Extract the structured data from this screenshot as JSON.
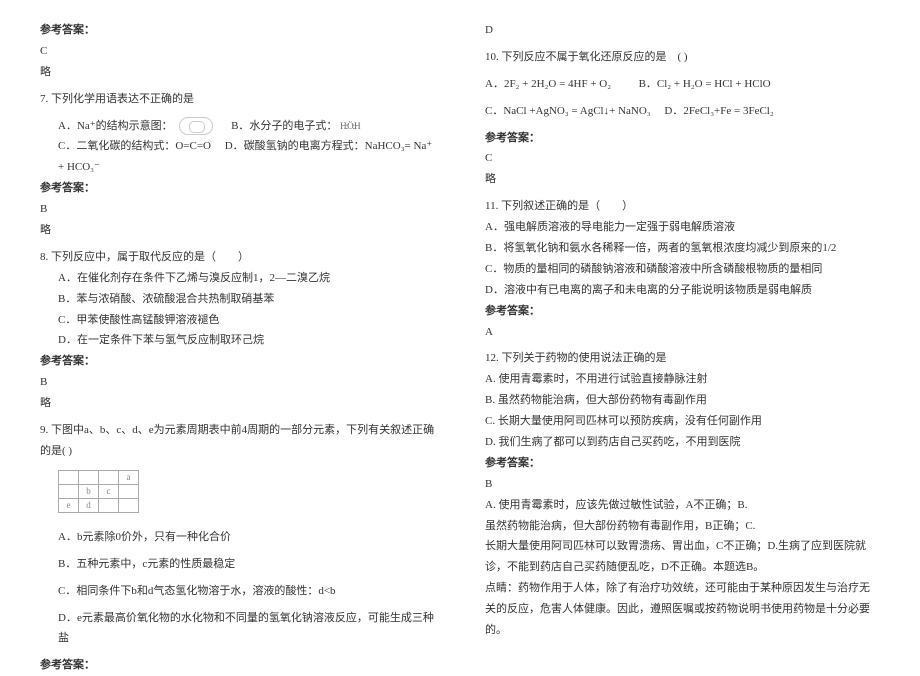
{
  "left": {
    "ans_label": "参考答案：",
    "lue": "略",
    "q6_ans": "C",
    "q7_stem": "7. 下列化学用语表达不正确的是",
    "q7_a": "A．Na⁺的结构示意图：",
    "q7_b": "B．水分子的电子式：",
    "q7_c": "C．二氧化碳的结构式：O=C=O",
    "q7_d": "D．碳酸氢钠的电离方程式：NaHCO₃= Na⁺ + HCO₃⁻",
    "q7_ans": "B",
    "q8_stem": "8. 下列反应中，属于取代反应的是（　　）",
    "q8_a": "A．在催化剂存在条件下乙烯与溴反应制1，2—二溴乙烷",
    "q8_b": "B．苯与浓硝酸、浓硫酸混合共热制取硝基苯",
    "q8_c": "C．甲苯使酸性高锰酸钾溶液褪色",
    "q8_d": "D．在一定条件下苯与氢气反应制取环己烷",
    "q8_ans": "B",
    "q9_stem": "9. 下图中a、b、c、d、e为元素周期表中前4周期的一部分元素，下列有关叙述正确的是(   )",
    "q9_a": "A．b元素除0价外，只有一种化合价",
    "q9_b": "B．五种元素中，c元素的性质最稳定",
    "q9_c": "C．相同条件下b和d气态氢化物溶于水，溶液的酸性：d<b",
    "q9_d": "D．e元素最高价氧化物的水化物和不同量的氢氧化钠溶液反应，可能生成三种盐",
    "q9_ans_label": "参考答案："
  },
  "right": {
    "q9_ans": "D",
    "q10_stem": "10. 下列反应不属于氧化还原反应的是　(    )",
    "q10_a": "A．2F₂ + 2H₂O = 4HF + O₂",
    "q10_b": "B．Cl₂ + H₂O = HCl + HClO",
    "q10_c": "C．NaCl +AgNO₃ = AgCl↓+ NaNO₃",
    "q10_d": "D．2FeCl₃+Fe = 3FeCl₂",
    "ans_label": "参考答案：",
    "q10_ans": "C",
    "lue": "略",
    "q11_stem": "11. 下列叙述正确的是（　　）",
    "q11_a": "A．强电解质溶液的导电能力一定强于弱电解质溶液",
    "q11_b": "B．将氢氧化钠和氨水各稀释一倍，两者的氢氧根浓度均减少到原来的1/2",
    "q11_c": "C．物质的量相同的磷酸钠溶液和磷酸溶液中所含磷酸根物质的量相同",
    "q11_d": "D．溶液中有已电离的离子和未电离的分子能说明该物质是弱电解质",
    "q11_ans": "A",
    "q12_stem": "12. 下列关于药物的使用说法正确的是",
    "q12_a": "A. 使用青霉素时，不用进行试验直接静脉注射",
    "q12_b": "B. 虽然药物能治病，但大部份药物有毒副作用",
    "q12_c": "C. 长期大量使用阿司匹林可以预防疾病，没有任何副作用",
    "q12_d": "D. 我们生病了都可以到药店自己买药吃，不用到医院",
    "q12_ans": "B",
    "q12_exp1": "A. 使用青霉素时，应该先做过敏性试验，A不正确；B.",
    "q12_exp2": "虽然药物能治病，但大部份药物有毒副作用，B正确；C.",
    "q12_exp3": "长期大量使用阿司匹林可以致胃溃疡、胃出血，C不正确；D.生病了应到医院就诊，不能到药店自己买药随便乱吃，D不正确。本题选B。",
    "q12_exp4": "点睛：药物作用于人体，除了有治疗功效统，还可能由于某种原因发生与治疗无关的反应，危害人体健康。因此，遵照医嘱或按药物说明书使用药物是十分必要的。"
  }
}
